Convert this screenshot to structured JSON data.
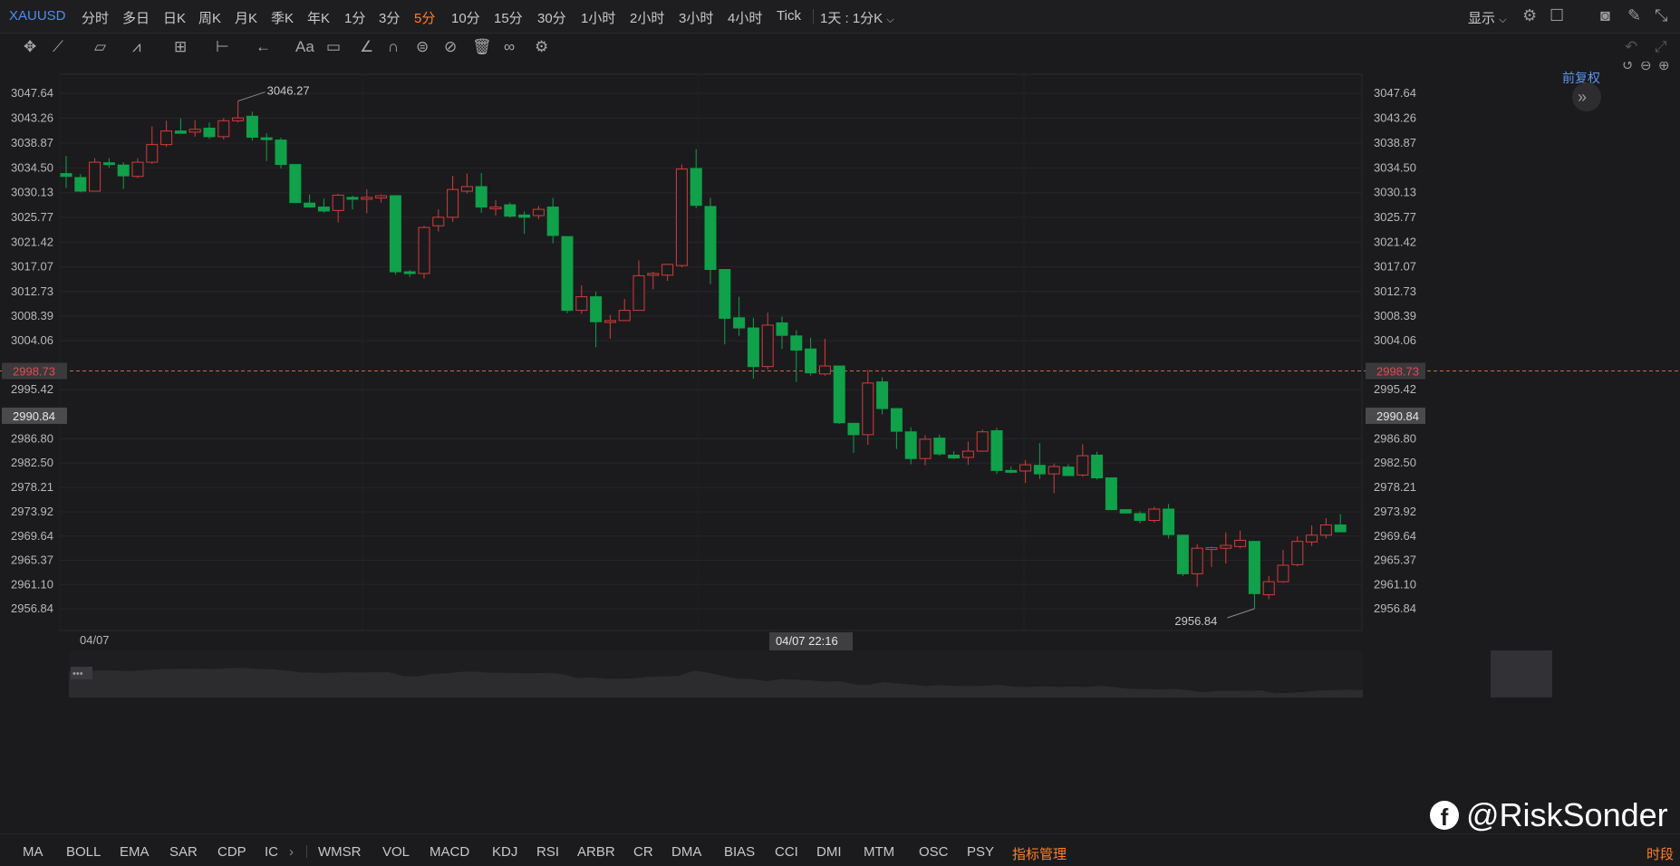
{
  "top_bar": {
    "symbol": "XAUUSD",
    "periods": [
      "分时",
      "多日",
      "日K",
      "周K",
      "月K",
      "季K",
      "年K",
      "1分",
      "3分",
      "5分",
      "10分",
      "15分",
      "30分",
      "1小时",
      "2小时",
      "3小时",
      "4小时",
      "Tick"
    ],
    "active_period": "5分",
    "multi_chart": "1天 : 1分K",
    "display": "显示"
  },
  "chart_header": {
    "fuquan": "前复权"
  },
  "icons": {
    "tools": [
      "move-icon",
      "line-tool-icon",
      "channel-tool-icon",
      "wave-tool-icon",
      "fib-tool-icon",
      "range-tool-icon",
      "arrow-tool-icon",
      "text-tool-icon",
      "comment-tool-icon",
      "pen-tool-icon",
      "magnet-icon",
      "lock-icon",
      "hide-icon",
      "trash-icon",
      "link-icon",
      "settings-icon"
    ],
    "right": [
      "settings-icon",
      "layout-icon",
      "camera-icon",
      "draw-icon",
      "shrink-icon",
      "undo-icon",
      "redo-icon",
      "maximize-icon"
    ]
  },
  "colors": {
    "up": "#d63b3b",
    "down": "#10a14a",
    "accent": "#ff7f2a",
    "link": "#5b93f4",
    "last_price_line": "#d0683a"
  },
  "chart_data": {
    "type": "candlestick",
    "symbol": "XAUUSD",
    "interval": "5分",
    "y_ticks": [
      3047.64,
      3043.26,
      3038.87,
      3034.5,
      3030.13,
      3025.77,
      3021.42,
      3017.07,
      3012.73,
      3008.39,
      3004.06,
      2995.42,
      2986.8,
      2982.5,
      2978.21,
      2973.92,
      2969.64,
      2965.37,
      2961.1,
      2956.84
    ],
    "ylim": [
      2954.0,
      3050.0
    ],
    "x_labels": [
      "04/07"
    ],
    "crosshair_time": "04/07 22:16",
    "last_price": 2998.73,
    "crosshair_price": 2990.84,
    "high_label": {
      "text": "3046.27",
      "value": 3046.27
    },
    "low_label": {
      "text": "2956.84",
      "value": 2956.84
    },
    "candles": [
      {
        "o": 3033.5,
        "h": 3036.6,
        "l": 3031.0,
        "c": 3033.0
      },
      {
        "o": 3032.8,
        "h": 3033.4,
        "l": 3030.2,
        "c": 3030.4
      },
      {
        "o": 3030.4,
        "h": 3036.2,
        "l": 3030.4,
        "c": 3035.5
      },
      {
        "o": 3035.4,
        "h": 3036.2,
        "l": 3034.5,
        "c": 3035.2
      },
      {
        "o": 3035.0,
        "h": 3035.5,
        "l": 3030.8,
        "c": 3033.1
      },
      {
        "o": 3033.0,
        "h": 3036.2,
        "l": 3032.7,
        "c": 3035.5
      },
      {
        "o": 3035.5,
        "h": 3041.8,
        "l": 3035.2,
        "c": 3038.6
      },
      {
        "o": 3038.6,
        "h": 3042.8,
        "l": 3038.2,
        "c": 3041.0
      },
      {
        "o": 3041.0,
        "h": 3043.2,
        "l": 3040.6,
        "c": 3040.6
      },
      {
        "o": 3040.8,
        "h": 3042.9,
        "l": 3040.0,
        "c": 3041.3
      },
      {
        "o": 3041.5,
        "h": 3042.5,
        "l": 3039.6,
        "c": 3040.0
      },
      {
        "o": 3040.0,
        "h": 3043.3,
        "l": 3039.5,
        "c": 3042.8
      },
      {
        "o": 3042.8,
        "h": 3046.27,
        "l": 3042.5,
        "c": 3043.3
      },
      {
        "o": 3043.6,
        "h": 3044.4,
        "l": 3039.3,
        "c": 3039.9
      },
      {
        "o": 3039.8,
        "h": 3040.6,
        "l": 3035.7,
        "c": 3039.5
      },
      {
        "o": 3039.4,
        "h": 3039.8,
        "l": 3034.4,
        "c": 3035.1
      },
      {
        "o": 3035.1,
        "h": 3035.1,
        "l": 3028.3,
        "c": 3028.4
      },
      {
        "o": 3028.3,
        "h": 3029.8,
        "l": 3027.6,
        "c": 3027.6
      },
      {
        "o": 3027.6,
        "h": 3029.1,
        "l": 3026.6,
        "c": 3026.9
      },
      {
        "o": 3027.0,
        "h": 3029.9,
        "l": 3024.9,
        "c": 3029.7
      },
      {
        "o": 3029.3,
        "h": 3029.6,
        "l": 3027.2,
        "c": 3029.1
      },
      {
        "o": 3029.2,
        "h": 3030.7,
        "l": 3026.5,
        "c": 3029.3
      },
      {
        "o": 3029.2,
        "h": 3029.8,
        "l": 3028.4,
        "c": 3029.6
      },
      {
        "o": 3029.6,
        "h": 3029.6,
        "l": 3015.7,
        "c": 3016.2
      },
      {
        "o": 3016.2,
        "h": 3016.5,
        "l": 3015.3,
        "c": 3015.9
      },
      {
        "o": 3015.9,
        "h": 3024.3,
        "l": 3015.0,
        "c": 3024.0
      },
      {
        "o": 3024.3,
        "h": 3027.2,
        "l": 3023.3,
        "c": 3025.8
      },
      {
        "o": 3025.8,
        "h": 3033.1,
        "l": 3025.0,
        "c": 3030.7
      },
      {
        "o": 3030.4,
        "h": 3033.5,
        "l": 3030.0,
        "c": 3031.2
      },
      {
        "o": 3031.2,
        "h": 3033.6,
        "l": 3026.6,
        "c": 3027.6
      },
      {
        "o": 3027.6,
        "h": 3028.8,
        "l": 3026.1,
        "c": 3027.6
      },
      {
        "o": 3028.0,
        "h": 3028.4,
        "l": 3025.7,
        "c": 3026.0
      },
      {
        "o": 3026.2,
        "h": 3026.8,
        "l": 3022.9,
        "c": 3025.8
      },
      {
        "o": 3026.1,
        "h": 3027.8,
        "l": 3025.5,
        "c": 3027.2
      },
      {
        "o": 3027.6,
        "h": 3029.2,
        "l": 3021.2,
        "c": 3022.6
      },
      {
        "o": 3022.4,
        "h": 3022.4,
        "l": 3008.9,
        "c": 3009.4
      },
      {
        "o": 3009.4,
        "h": 3013.8,
        "l": 3008.8,
        "c": 3011.8
      },
      {
        "o": 3011.8,
        "h": 3012.7,
        "l": 3002.9,
        "c": 3007.4
      },
      {
        "o": 3007.6,
        "h": 3008.6,
        "l": 3004.4,
        "c": 3007.6
      },
      {
        "o": 3007.6,
        "h": 3011.4,
        "l": 3007.5,
        "c": 3009.4
      },
      {
        "o": 3009.4,
        "h": 3018.2,
        "l": 3009.4,
        "c": 3015.5
      },
      {
        "o": 3015.6,
        "h": 3016.2,
        "l": 3013.1,
        "c": 3015.9
      },
      {
        "o": 3015.6,
        "h": 3017.4,
        "l": 3014.6,
        "c": 3017.5
      },
      {
        "o": 3017.3,
        "h": 3035.1,
        "l": 3017.0,
        "c": 3034.3
      },
      {
        "o": 3034.4,
        "h": 3037.8,
        "l": 3027.4,
        "c": 3027.9
      },
      {
        "o": 3027.7,
        "h": 3029.2,
        "l": 3014.0,
        "c": 3016.6
      },
      {
        "o": 3016.6,
        "h": 3016.6,
        "l": 3003.4,
        "c": 3008.0
      },
      {
        "o": 3008.1,
        "h": 3011.8,
        "l": 3004.9,
        "c": 3006.3
      },
      {
        "o": 3006.3,
        "h": 3008.1,
        "l": 2997.4,
        "c": 2999.5
      },
      {
        "o": 2999.5,
        "h": 3009.0,
        "l": 2999.0,
        "c": 3006.8
      },
      {
        "o": 3007.2,
        "h": 3008.3,
        "l": 3002.6,
        "c": 3005.0
      },
      {
        "o": 3004.9,
        "h": 3005.9,
        "l": 2996.8,
        "c": 3002.4
      },
      {
        "o": 3002.6,
        "h": 3004.6,
        "l": 2997.9,
        "c": 2998.4
      },
      {
        "o": 2998.2,
        "h": 3004.4,
        "l": 2997.9,
        "c": 2999.6
      },
      {
        "o": 2999.6,
        "h": 2999.6,
        "l": 2989.4,
        "c": 2989.6
      },
      {
        "o": 2989.5,
        "h": 2989.5,
        "l": 2984.3,
        "c": 2987.5
      },
      {
        "o": 2987.5,
        "h": 2998.9,
        "l": 2985.7,
        "c": 2996.6
      },
      {
        "o": 2996.8,
        "h": 2997.6,
        "l": 2991.1,
        "c": 2992.1
      },
      {
        "o": 2992.1,
        "h": 2992.1,
        "l": 2985.0,
        "c": 2988.1
      },
      {
        "o": 2988.0,
        "h": 2988.8,
        "l": 2982.3,
        "c": 2983.3
      },
      {
        "o": 2983.3,
        "h": 2987.4,
        "l": 2982.1,
        "c": 2986.7
      },
      {
        "o": 2986.9,
        "h": 2987.5,
        "l": 2983.8,
        "c": 2984.1
      },
      {
        "o": 2983.9,
        "h": 2984.6,
        "l": 2983.2,
        "c": 2983.4
      },
      {
        "o": 2983.5,
        "h": 2986.3,
        "l": 2982.2,
        "c": 2984.6
      },
      {
        "o": 2984.6,
        "h": 2988.4,
        "l": 2984.5,
        "c": 2988.0
      },
      {
        "o": 2988.2,
        "h": 2988.7,
        "l": 2980.6,
        "c": 2981.2
      },
      {
        "o": 2981.2,
        "h": 2981.9,
        "l": 2980.7,
        "c": 2980.9
      },
      {
        "o": 2981.1,
        "h": 2983.0,
        "l": 2979.0,
        "c": 2982.2
      },
      {
        "o": 2982.1,
        "h": 2986.0,
        "l": 2979.7,
        "c": 2980.6
      },
      {
        "o": 2980.6,
        "h": 2982.4,
        "l": 2977.2,
        "c": 2981.9
      },
      {
        "o": 2981.8,
        "h": 2982.3,
        "l": 2980.3,
        "c": 2980.3
      },
      {
        "o": 2980.4,
        "h": 2985.8,
        "l": 2980.1,
        "c": 2983.8
      },
      {
        "o": 2983.9,
        "h": 2984.5,
        "l": 2979.6,
        "c": 2979.9
      },
      {
        "o": 2979.9,
        "h": 2980.0,
        "l": 2974.2,
        "c": 2974.3
      },
      {
        "o": 2974.3,
        "h": 2974.3,
        "l": 2973.6,
        "c": 2973.7
      },
      {
        "o": 2973.6,
        "h": 2974.0,
        "l": 2971.9,
        "c": 2972.4
      },
      {
        "o": 2972.4,
        "h": 2974.8,
        "l": 2972.0,
        "c": 2974.4
      },
      {
        "o": 2974.4,
        "h": 2975.3,
        "l": 2969.2,
        "c": 2969.9
      },
      {
        "o": 2969.8,
        "h": 2969.8,
        "l": 2962.6,
        "c": 2963.0
      },
      {
        "o": 2963.0,
        "h": 2968.2,
        "l": 2960.7,
        "c": 2967.5
      },
      {
        "o": 2967.3,
        "h": 2967.8,
        "l": 2964.2,
        "c": 2967.6
      },
      {
        "o": 2967.5,
        "h": 2970.3,
        "l": 2964.8,
        "c": 2968.0
      },
      {
        "o": 2967.8,
        "h": 2970.6,
        "l": 2967.5,
        "c": 2968.9
      },
      {
        "o": 2968.7,
        "h": 2968.7,
        "l": 2956.84,
        "c": 2959.5
      },
      {
        "o": 2959.3,
        "h": 2962.6,
        "l": 2958.5,
        "c": 2961.6
      },
      {
        "o": 2961.6,
        "h": 2967.2,
        "l": 2961.4,
        "c": 2964.5
      },
      {
        "o": 2964.6,
        "h": 2969.6,
        "l": 2964.3,
        "c": 2968.7
      },
      {
        "o": 2968.6,
        "h": 2971.5,
        "l": 2967.9,
        "c": 2969.8
      },
      {
        "o": 2969.8,
        "h": 2972.8,
        "l": 2969.2,
        "c": 2971.6
      },
      {
        "o": 2971.6,
        "h": 2973.5,
        "l": 2970.6,
        "c": 2970.4
      }
    ]
  },
  "indicators": [
    "MA",
    "BOLL",
    "EMA",
    "SAR",
    "CDP",
    "IC",
    "WMSR",
    "VOL",
    "MACD",
    "KDJ",
    "RSI",
    "ARBR",
    "CR",
    "DMA",
    "BIAS",
    "CCI",
    "DMI",
    "MTM",
    "OSC",
    "PSY"
  ],
  "indicator_manage": "指标管理",
  "time_segment": "时段",
  "watermark": {
    "logo_letter": "f",
    "text": "@RiskSonder"
  }
}
